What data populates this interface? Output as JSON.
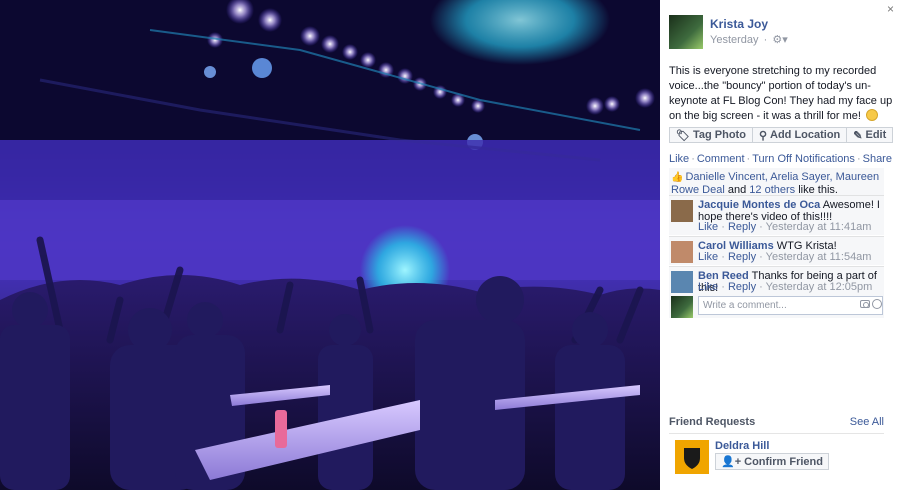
{
  "window": {
    "close_glyph": "×"
  },
  "post": {
    "author": "Krista Joy",
    "time": "Yesterday",
    "privacy_icon": "friends-gear-icon",
    "text": "This is everyone stretching to my recorded voice...the \"bouncy\" portion of today's un-keynote at FL Blog Con! They had my face up on the big screen - it was a thrill for me!",
    "emoji": "smile-emoji-icon"
  },
  "actions": {
    "tag_photo": "Tag Photo",
    "add_location": "Add Location",
    "edit": "Edit"
  },
  "ufi": {
    "like": "Like",
    "comment": "Comment",
    "turn_off": "Turn Off Notifications",
    "share": "Share"
  },
  "likes": {
    "names": "Danielle Vincent, Arelia Sayer, Maureen Rowe Deal",
    "and_text": "and",
    "others": "12 others",
    "suffix": "like this."
  },
  "comments": [
    {
      "author": "Jacquie Montes de Oca",
      "text": "Awesome! I hope there's video of this!!!!",
      "like": "Like",
      "reply": "Reply",
      "time": "Yesterday at 11:41am",
      "avatar_color": "#8a6a4a"
    },
    {
      "author": "Carol Williams",
      "text": "WTG Krista!",
      "like": "Like",
      "reply": "Reply",
      "time": "Yesterday at 11:54am",
      "avatar_color": "#c08a6a"
    },
    {
      "author": "Ben Reed",
      "text": "Thanks for being a part of this!",
      "like": "Like",
      "reply": "Reply",
      "time": "Yesterday at 12:05pm",
      "avatar_color": "#5a86b0"
    }
  ],
  "write_comment": {
    "placeholder": "Write a comment..."
  },
  "friend_requests": {
    "title": "Friend Requests",
    "see_all": "See All",
    "items": [
      {
        "name": "Deldra Hill",
        "confirm_label": "Confirm Friend",
        "avatar_color": "#f0a500"
      }
    ]
  },
  "colors": {
    "link": "#3b5998",
    "meta": "#9197a3",
    "stage_purple": "#4b33c8"
  }
}
